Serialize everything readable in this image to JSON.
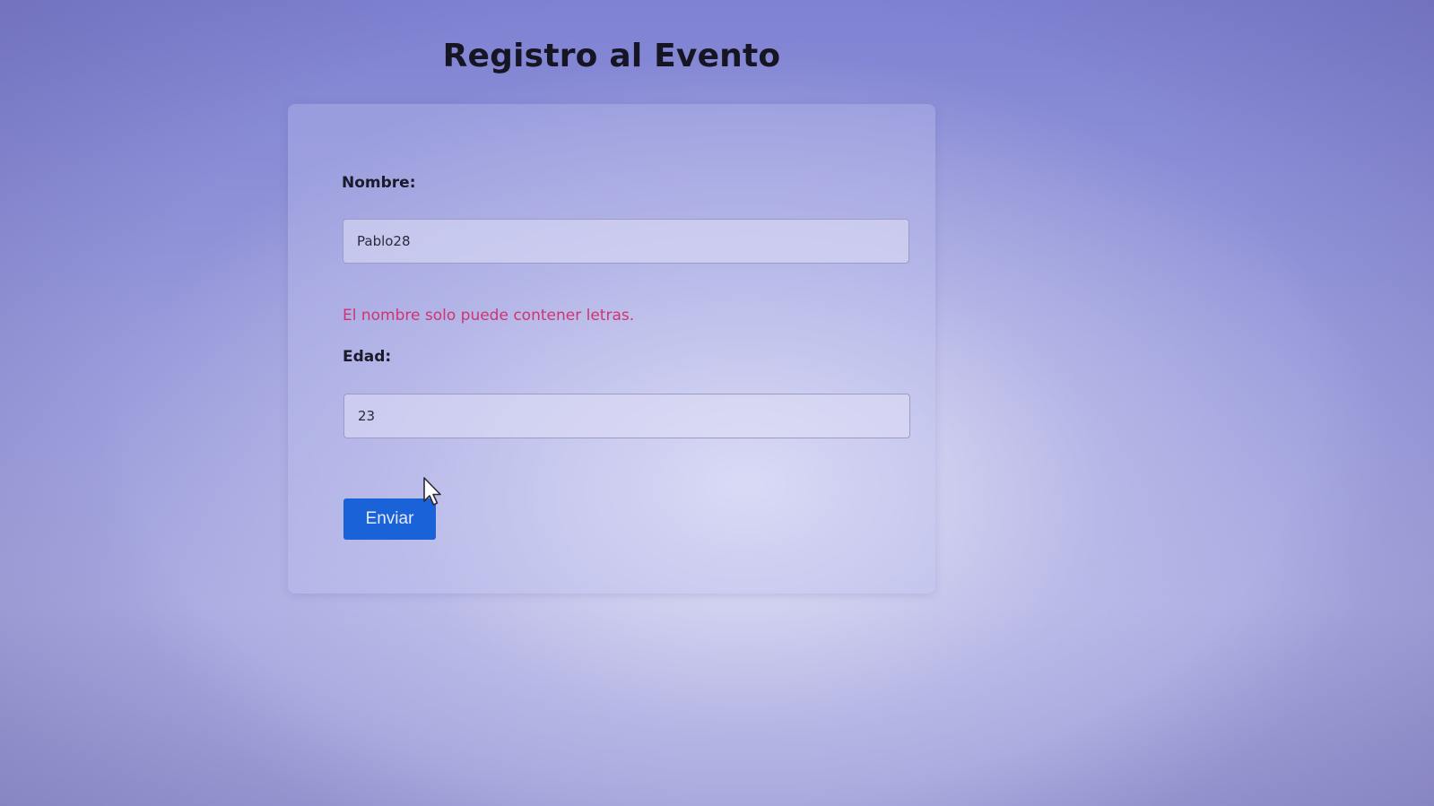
{
  "page": {
    "title": "Registro al Evento"
  },
  "form": {
    "name_label": "Nombre:",
    "name_value": "Pablo28",
    "name_error": "El nombre solo puede contener letras.",
    "age_label": "Edad:",
    "age_value": "23",
    "submit_label": "Enviar"
  },
  "colors": {
    "error": "#cf3470",
    "button": "#1a62d8"
  },
  "icons": {
    "cursor": "mouse-cursor-icon"
  }
}
